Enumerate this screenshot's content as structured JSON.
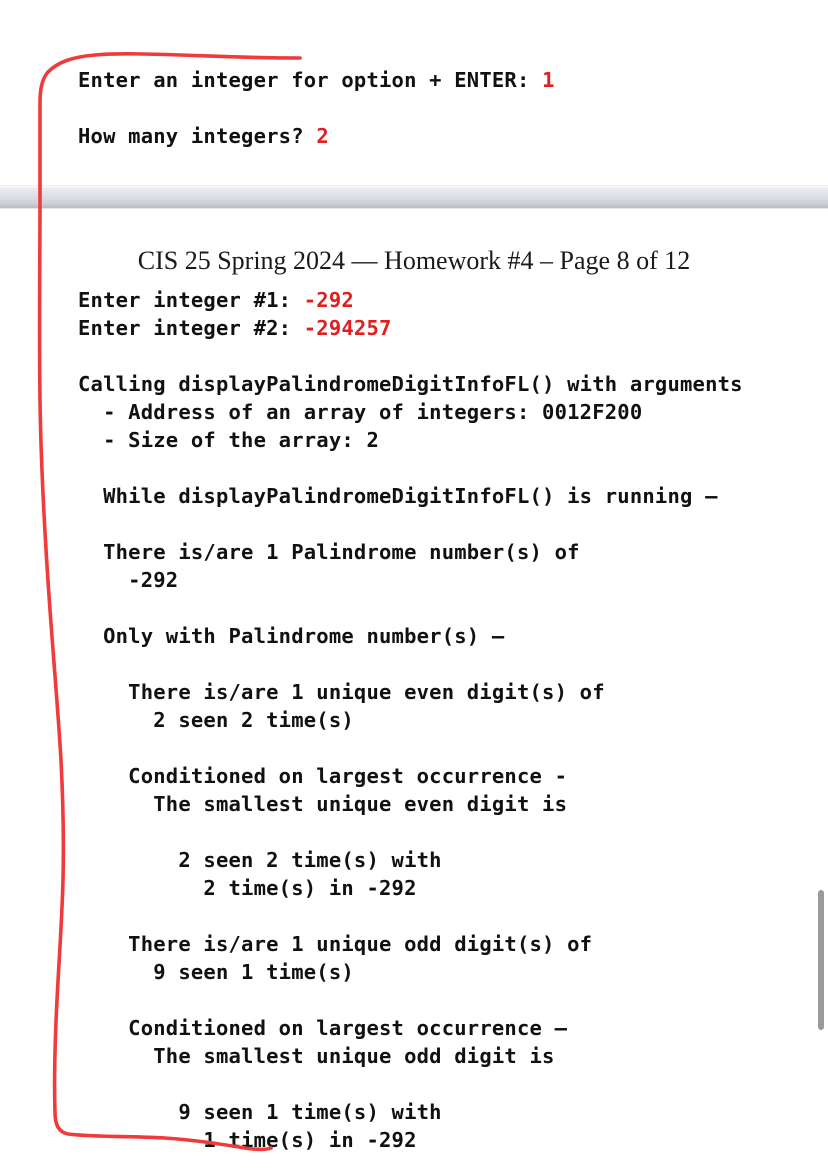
{
  "document": {
    "header": "CIS 25 Spring 2024 — Homework #4 – Page 8 of 12"
  },
  "top_console": {
    "line1_label": "Enter an integer for option + ENTER: ",
    "line1_value": "1",
    "line2_label": "How many integers? ",
    "line2_value": "2"
  },
  "console_output": {
    "l01_label": "Enter integer #1: ",
    "l01_value": "-292",
    "l02_label": "Enter integer #2: ",
    "l02_value": "-294257",
    "l03": "",
    "l04": "Calling displayPalindromeDigitInfoFL() with arguments",
    "l05": "  - Address of an array of integers: 0012F200",
    "l06": "  - Size of the array: 2",
    "l07": "",
    "l08": "  While displayPalindromeDigitInfoFL() is running –",
    "l09": "",
    "l10": "  There is/are 1 Palindrome number(s) of",
    "l11": "    -292",
    "l12": "",
    "l13": "  Only with Palindrome number(s) –",
    "l14": "",
    "l15": "    There is/are 1 unique even digit(s) of",
    "l16": "      2 seen 2 time(s)",
    "l17": "",
    "l18": "    Conditioned on largest occurrence -",
    "l19": "      The smallest unique even digit is",
    "l20": "",
    "l21": "        2 seen 2 time(s) with",
    "l22": "          2 time(s) in -292",
    "l23": "",
    "l24": "    There is/are 1 unique odd digit(s) of",
    "l25": "      9 seen 1 time(s)",
    "l26": "",
    "l27": "    Conditioned on largest occurrence –",
    "l28": "      The smallest unique odd digit is",
    "l29": "",
    "l30": "        9 seen 1 time(s) with",
    "l31": "          1 time(s) in -292"
  },
  "annotation": {
    "color": "#ef3b3b",
    "shape": "bracket-marking-output-block"
  },
  "scrollbar": {
    "color": "#9a9a9a"
  }
}
